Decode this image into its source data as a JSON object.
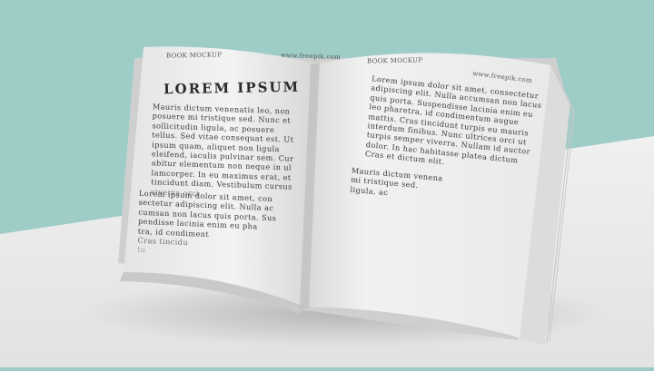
{
  "image": {
    "alt": "Open book mockup on white surface against teal background"
  },
  "left_page": {
    "header_left": "BOOK MOCKUP",
    "header_right": "www.freepik.com",
    "title": "LOREM IPSUM",
    "paragraph1": [
      "Mauris dictum venenatis leo, non",
      "posuere mi tristique sed. Nunc et",
      "sollicitudin ligula, ac posuere",
      "tellus. Sed vitae consequat est. Ut",
      "ipsum quam, aliquet non ligula",
      "eleifend, iaculis pulvinar sem. Cur",
      "abitur elementum non neque in ul",
      "lamcorper. In eu maximus erat, et",
      "tincidunt diam. Vestibulum cursus",
      "viverra orci"
    ],
    "paragraph2": [
      "Lorem ipsum dolor sit amet, con",
      "sectetur adipiscing elit. Nulla ac",
      "cumsan non lacus quis porta. Sus",
      "pendisse lacinia enim eu pha",
      "tra, id condiment",
      "Cras tincidu",
      "tu"
    ]
  },
  "right_page": {
    "header_left": "BOOK MOCKUP",
    "header_right": "www.freepik.com",
    "paragraph1": [
      "Lorem ipsum dolor sit amet, consectetur",
      "adipiscing elit. Nulla accumsan non lacus",
      "quis porta. Suspendisse lacinia enim eu",
      "leo pharetra, id condimentum augue",
      "mattis. Cras tincidunt turpis eu mauris",
      "interdum finibus. Nunc ultrices orci ut",
      "turpis semper viverra. Nullam id auctor",
      "dolor. In hac habitasse platea dictum",
      "Cras et dictum elit."
    ],
    "paragraph2": [
      "Mauris dictum venena",
      "mi tristique sed.",
      "ligula, ac"
    ]
  },
  "colors": {
    "background": "#9ecdc8",
    "surface": "#e9e9ea",
    "page": "#f1f1f1",
    "text": "#3a3a3a"
  }
}
